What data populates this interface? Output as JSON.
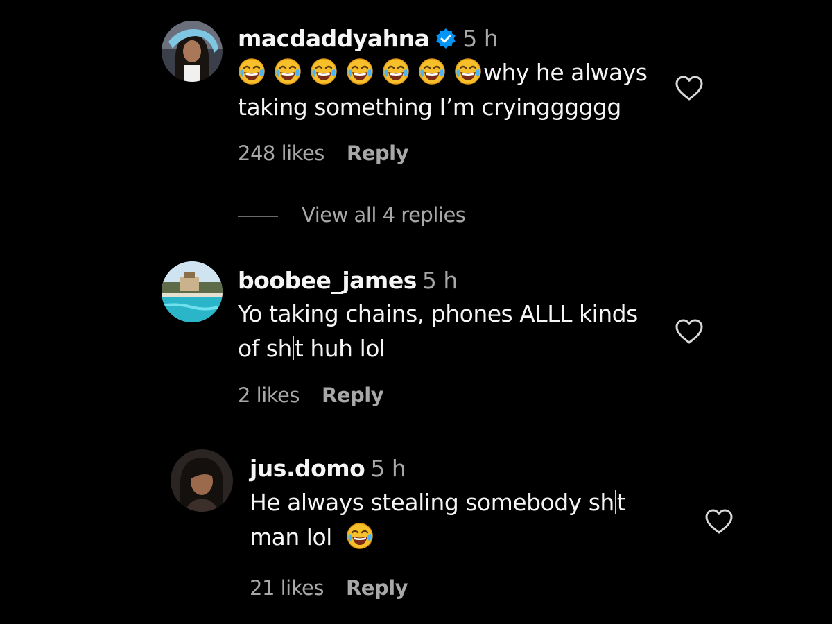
{
  "comments": [
    {
      "username": "macdaddyahna",
      "verified": true,
      "time": "5 h",
      "emoji_prefix": [
        "face-with-tears-of-joy-icon",
        "face-with-tears-of-joy-icon",
        "face-with-tears-of-joy-icon",
        "face-with-tears-of-joy-icon",
        "face-with-tears-of-joy-icon",
        "face-with-tears-of-joy-icon",
        "face-with-tears-of-joy-icon"
      ],
      "text_line1": "why he always",
      "text_line2": "taking something I’m cryingggggg",
      "likes": "248 likes",
      "reply_label": "Reply",
      "view_replies": "View all 4 replies"
    },
    {
      "username": "boobee_james",
      "verified": false,
      "time": "5 h",
      "text_line1": "Yo taking chains, phones ALLL kinds",
      "text_line2_a": "of sh",
      "text_line2_b": "t huh lol",
      "likes": "2 likes",
      "reply_label": "Reply"
    },
    {
      "username": "jus.domo",
      "verified": false,
      "time": "5 h",
      "text_line1_a": "He always stealing somebody sh",
      "text_line1_b": "t",
      "text_line2": "man lol",
      "emoji_suffix": "face-with-tears-of-joy-icon",
      "likes": "21 likes",
      "reply_label": "Reply"
    }
  ],
  "colors": {
    "background": "#000000",
    "primary_text": "#f5f5f5",
    "secondary_text": "#a8a8a8",
    "verified_badge": "#0095f6"
  },
  "icons": {
    "like": "heart-outline-icon",
    "verified": "verified-badge-icon"
  }
}
